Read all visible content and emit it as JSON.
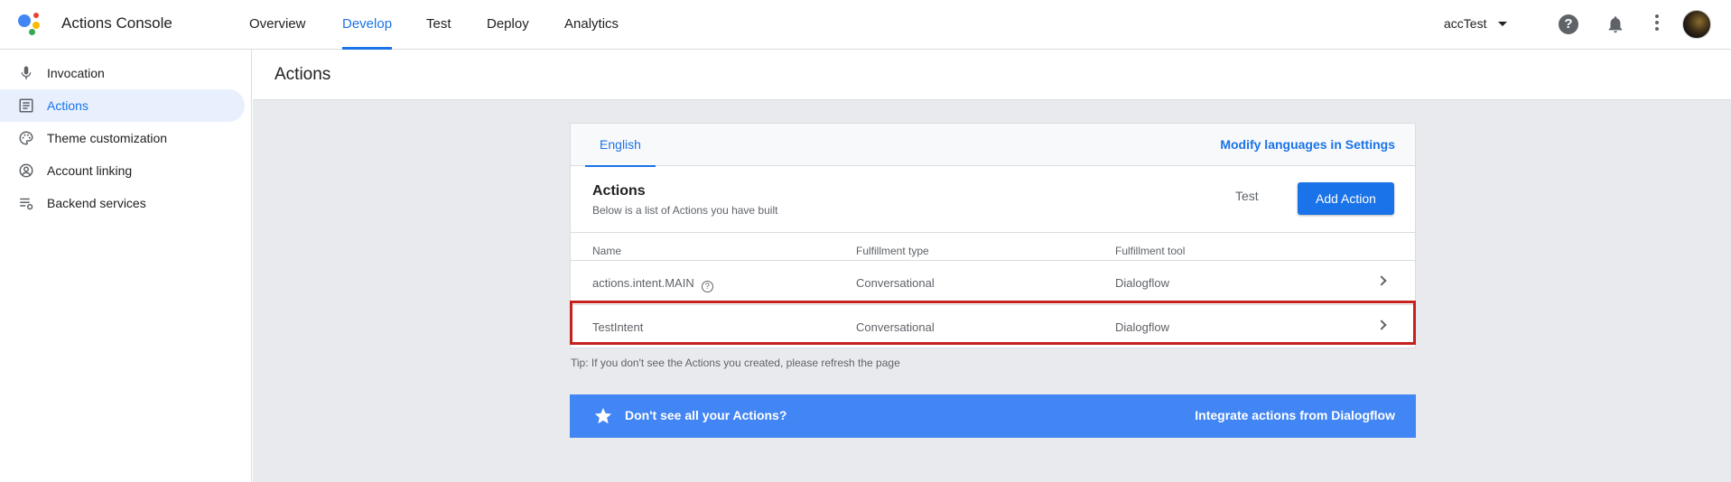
{
  "app": {
    "title": "Actions Console"
  },
  "nav": {
    "tabs": [
      {
        "label": "Overview",
        "active": false
      },
      {
        "label": "Develop",
        "active": true
      },
      {
        "label": "Test",
        "active": false
      },
      {
        "label": "Deploy",
        "active": false
      },
      {
        "label": "Analytics",
        "active": false
      }
    ]
  },
  "header_right": {
    "project": "accTest",
    "icons": [
      "help-icon",
      "bell-icon",
      "more-vert-icon",
      "avatar"
    ]
  },
  "sidebar": {
    "items": [
      {
        "label": "Invocation",
        "icon": "mic-icon",
        "active": false
      },
      {
        "label": "Actions",
        "icon": "list-icon",
        "active": true
      },
      {
        "label": "Theme customization",
        "icon": "palette-icon",
        "active": false
      },
      {
        "label": "Account linking",
        "icon": "account-circle-icon",
        "active": false
      },
      {
        "label": "Backend services",
        "icon": "settings-list-icon",
        "active": false
      }
    ]
  },
  "page": {
    "title": "Actions"
  },
  "card": {
    "language_tab": "English",
    "modify_link": "Modify languages in Settings",
    "title": "Actions",
    "subtitle": "Below is a list of Actions you have built",
    "test_button": "Test",
    "add_button": "Add Action",
    "columns": [
      "Name",
      "Fulfillment type",
      "Fulfillment tool"
    ],
    "rows": [
      {
        "name": "actions.intent.MAIN",
        "type": "Conversational",
        "tool": "Dialogflow",
        "has_help": true
      },
      {
        "name": "TestIntent",
        "type": "Conversational",
        "tool": "Dialogflow",
        "highlighted": true
      }
    ]
  },
  "tip": "Tip: If you don't see the Actions you created, please refresh the page",
  "banner": {
    "text": "Don't see all your Actions?",
    "link": "Integrate actions from Dialogflow"
  },
  "colors": {
    "accent": "#1a73e8",
    "banner": "#4285f4",
    "highlight": "#c5221f"
  }
}
